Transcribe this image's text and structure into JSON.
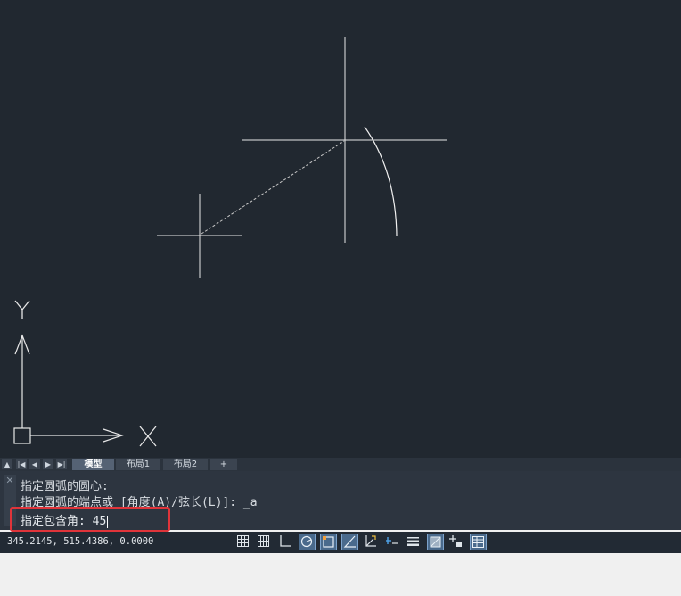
{
  "layout_tabs": {
    "model": "模型",
    "layout1": "布局1",
    "layout2": "布局2",
    "add": "+"
  },
  "nav_glyphs": {
    "up": "▲",
    "first": "|◀",
    "prev": "◀",
    "next": "▶",
    "last": "▶|"
  },
  "ucs": {
    "x_label": "X",
    "y_label": "Y"
  },
  "command": {
    "close_glyph": "✕",
    "history": [
      "指定圆弧的圆心:",
      "指定圆弧的端点或 [角度(A)/弦长(L)]: _a"
    ],
    "prompt": "指定包含角: ",
    "input_value": "45"
  },
  "status": {
    "coordinates": "345.2145, 515.4386, 0.0000",
    "toggles": [
      {
        "name": "grid-icon",
        "on": false
      },
      {
        "name": "snap-grid-icon",
        "on": false
      },
      {
        "name": "ortho-icon",
        "on": false
      },
      {
        "name": "polar-icon",
        "on": true
      },
      {
        "name": "object-snap-icon",
        "on": true
      },
      {
        "name": "snap-tracking-icon",
        "on": true
      },
      {
        "name": "dynamic-ucs-icon",
        "on": false
      },
      {
        "name": "dynamic-input-icon",
        "on": false
      },
      {
        "name": "lineweight-icon",
        "on": false
      },
      {
        "name": "transparency-icon",
        "on": true
      },
      {
        "name": "selection-cycling-icon",
        "on": false
      },
      {
        "name": "quick-properties-icon",
        "on": true
      }
    ]
  },
  "colors": {
    "canvas_bg": "#212830",
    "highlight_box": "#e0343a",
    "toggle_on": "#4a6a8c"
  }
}
